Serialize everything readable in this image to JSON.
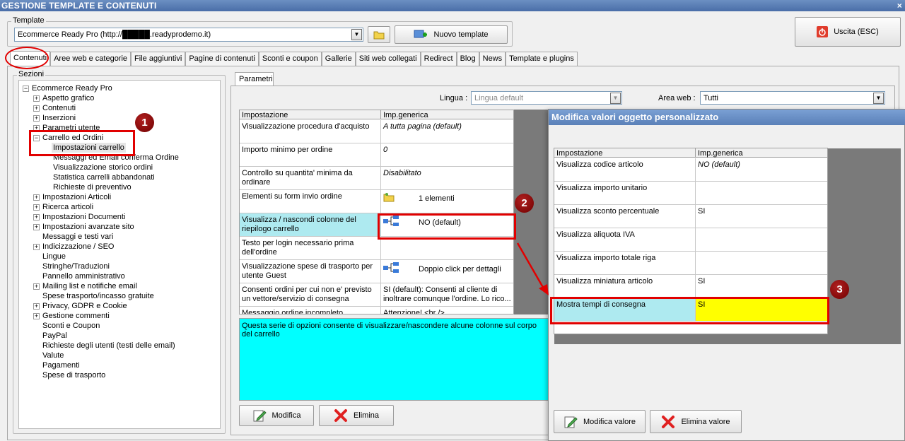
{
  "window": {
    "title": "GESTIONE TEMPLATE E CONTENUTI",
    "close": "×"
  },
  "template_group": {
    "legend": "Template",
    "selected": "Ecommerce Ready Pro (http://█████.readyprodemo.it)",
    "new_button": "Nuovo template"
  },
  "exit_button": "Uscita (ESC)",
  "tabs": [
    "Contenuti",
    "Aree web e categorie",
    "File aggiuntivi",
    "Pagine di contenuti",
    "Sconti e coupon",
    "Gallerie",
    "Siti web collegati",
    "Redirect",
    "Blog",
    "News",
    "Template e plugins"
  ],
  "sezioni": {
    "legend": "Sezioni",
    "root": "Ecommerce Ready Pro",
    "items": [
      {
        "label": "Aspetto grafico",
        "exp": "+"
      },
      {
        "label": "Contenuti",
        "exp": "+"
      },
      {
        "label": "Inserzioni",
        "exp": "+"
      },
      {
        "label": "Parametri utente",
        "exp": "+"
      },
      {
        "label": "Carrello ed Ordini",
        "exp": "−"
      },
      {
        "label": "Impostazioni carrello",
        "child": true
      },
      {
        "label": "Messaggi ed Email conferma Ordine",
        "child": true
      },
      {
        "label": "Visualizzazione storico ordini",
        "child": true
      },
      {
        "label": "Statistica carrelli abbandonati",
        "child": true
      },
      {
        "label": "Richieste di preventivo",
        "child": true
      },
      {
        "label": "Impostazioni Articoli",
        "exp": "+"
      },
      {
        "label": "Ricerca articoli",
        "exp": "+"
      },
      {
        "label": "Impostazioni Documenti",
        "exp": "+"
      },
      {
        "label": "Impostazioni avanzate sito",
        "exp": "+"
      },
      {
        "label": "Messaggi e testi vari"
      },
      {
        "label": "Indicizzazione / SEO",
        "exp": "+"
      },
      {
        "label": "Lingue"
      },
      {
        "label": "Stringhe/Traduzioni"
      },
      {
        "label": "Pannello amministrativo"
      },
      {
        "label": "Mailing list e notifiche email",
        "exp": "+"
      },
      {
        "label": "Spese trasporto/incasso gratuite"
      },
      {
        "label": "Privacy, GDPR e Cookie",
        "exp": "+"
      },
      {
        "label": "Gestione commenti",
        "exp": "+"
      },
      {
        "label": "Sconti e Coupon"
      },
      {
        "label": "PayPal"
      },
      {
        "label": "Richieste degli utenti (testi delle email)"
      },
      {
        "label": "Valute"
      },
      {
        "label": "Pagamenti"
      },
      {
        "label": "Spese di trasporto"
      }
    ]
  },
  "params": {
    "tab": "Parametri",
    "lingua_label": "Lingua :",
    "lingua_value": "Lingua default",
    "area_label": "Area web :",
    "area_value": "Tutti",
    "col1": "Impostazione",
    "col2": "Imp.generica",
    "rows": [
      {
        "name": "Visualizzazione procedura d'acquisto",
        "value": "A tutta pagina (default)"
      },
      {
        "name": "Importo minimo per ordine",
        "value": "0"
      },
      {
        "name": "Controllo su quantita' minima da ordinare",
        "value": "Disabilitato"
      },
      {
        "name": "Elementi su form invio ordine",
        "value": "1 elementi"
      },
      {
        "name": "Visualizza / nascondi colonne del riepilogo carrello",
        "value": "NO (default)"
      },
      {
        "name": "Testo per login necessario prima dell'ordine",
        "value": ""
      },
      {
        "name": "Visualizzazione spese di trasporto per utente Guest",
        "value": "Doppio click per dettagli"
      },
      {
        "name": "Consenti ordini per cui non e' previsto un vettore/servizio di consegna",
        "value": "SI (default): Consenti al cliente di inoltrare comunque l'ordine. Lo rico..."
      },
      {
        "name": "Messaggio ordine incompleto",
        "value": "Attenzione! <br />"
      }
    ],
    "description": "Questa serie di opzioni consente di visualizzare/nascondere alcune colonne sul corpo del carrello",
    "modifica": "Modifica",
    "elimina": "Elimina"
  },
  "dialog": {
    "title": "Modifica valori oggetto personalizzato",
    "col1": "Impostazione",
    "col2": "Imp.generica",
    "rows": [
      {
        "name": "Visualizza codice articolo",
        "value": "NO (default)"
      },
      {
        "name": "Visualizza importo unitario",
        "value": ""
      },
      {
        "name": "Visualizza sconto percentuale",
        "value": "SI"
      },
      {
        "name": "Visualizza aliquota IVA",
        "value": ""
      },
      {
        "name": "Visualizza importo totale riga",
        "value": ""
      },
      {
        "name": "Visualizza miniatura articolo",
        "value": "SI"
      },
      {
        "name": "Mostra tempi di consegna",
        "value": "SI"
      }
    ],
    "modifica": "Modifica valore",
    "elimina": "Elimina valore"
  },
  "annotations": [
    "1",
    "2",
    "3"
  ],
  "colors": {
    "title_bar": "#4a6ea8",
    "highlight_red": "#e10000",
    "selection": "#aeeaf0",
    "yellow": "#ffff00",
    "description_bg": "#00ffff"
  }
}
